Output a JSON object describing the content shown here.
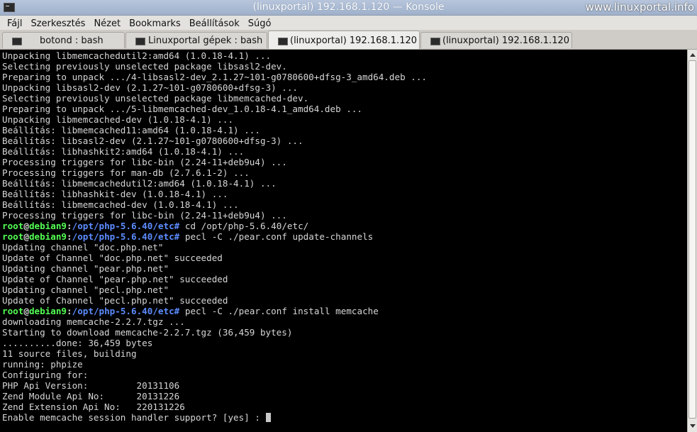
{
  "window": {
    "title": "(linuxportal) 192.168.1.120 — Konsole",
    "watermark": "www.linuxportal.info"
  },
  "menu": [
    "Fájl",
    "Szerkesztés",
    "Nézet",
    "Bookmarks",
    "Beállítások",
    "Súgó"
  ],
  "tabs": [
    {
      "label": "botond : bash"
    },
    {
      "label": "Linuxportal gépek : bash"
    },
    {
      "label": "(linuxportal) 192.168.1.120"
    },
    {
      "label": "(linuxportal) 192.168.1.120"
    }
  ],
  "prompt": {
    "user": "root",
    "at": "@",
    "host": "debian9",
    "colon": ":",
    "path": "/opt/php-5.6.40/etc",
    "symbol": "#"
  },
  "terminal": {
    "lines": [
      "Unpacking libmemcachedutil2:amd64 (1.0.18-4.1) ...",
      "Selecting previously unselected package libsasl2-dev.",
      "Preparing to unpack .../4-libsasl2-dev_2.1.27~101-g0780600+dfsg-3_amd64.deb ...",
      "Unpacking libsasl2-dev (2.1.27~101-g0780600+dfsg-3) ...",
      "Selecting previously unselected package libmemcached-dev.",
      "Preparing to unpack .../5-libmemcached-dev_1.0.18-4.1_amd64.deb ...",
      "Unpacking libmemcached-dev (1.0.18-4.1) ...",
      "Beállítás: libmemcached11:amd64 (1.0.18-4.1) ...",
      "Beállítás: libsasl2-dev (2.1.27~101-g0780600+dfsg-3) ...",
      "Beállítás: libhashkit2:amd64 (1.0.18-4.1) ...",
      "Processing triggers for libc-bin (2.24-11+deb9u4) ...",
      "Processing triggers for man-db (2.7.6.1-2) ...",
      "Beállítás: libmemcachedutil2:amd64 (1.0.18-4.1) ...",
      "Beállítás: libhashkit-dev (1.0.18-4.1) ...",
      "Beállítás: libmemcached-dev (1.0.18-4.1) ...",
      "Processing triggers for libc-bin (2.24-11+deb9u4) ..."
    ],
    "cmd1": "cd /opt/php-5.6.40/etc/",
    "cmd2": "pecl -C ./pear.conf update-channels",
    "lines2": [
      "Updating channel \"doc.php.net\"",
      "Update of Channel \"doc.php.net\" succeeded",
      "Updating channel \"pear.php.net\"",
      "Update of Channel \"pear.php.net\" succeeded",
      "Updating channel \"pecl.php.net\"",
      "Update of Channel \"pecl.php.net\" succeeded"
    ],
    "cmd3": "pecl -C ./pear.conf install memcache",
    "lines3": [
      "downloading memcache-2.2.7.tgz ...",
      "Starting to download memcache-2.2.7.tgz (36,459 bytes)",
      "..........done: 36,459 bytes",
      "11 source files, building",
      "running: phpize",
      "Configuring for:",
      "PHP Api Version:         20131106",
      "Zend Module Api No:      20131226",
      "Zend Extension Api No:   220131226"
    ],
    "last_line": "Enable memcache session handler support? [yes] : "
  }
}
